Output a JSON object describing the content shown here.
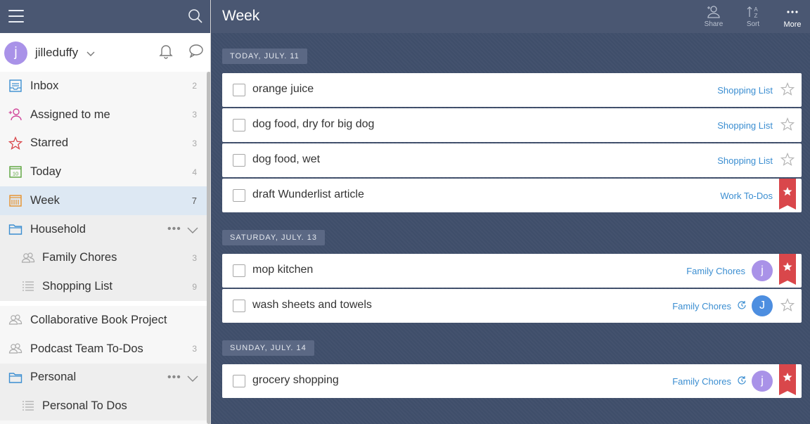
{
  "sidebar": {
    "user": {
      "initial": "j",
      "name": "jilleduffy"
    },
    "items": [
      {
        "label": "Inbox",
        "count": "2"
      },
      {
        "label": "Assigned to me",
        "count": "3"
      },
      {
        "label": "Starred",
        "count": "3"
      },
      {
        "label": "Today",
        "count": "4"
      },
      {
        "label": "Week",
        "count": "7"
      },
      {
        "label": "Household",
        "dots": "•••"
      },
      {
        "label": "Family Chores",
        "count": "3"
      },
      {
        "label": "Shopping List",
        "count": "9"
      },
      {
        "label": "Collaborative Book Project",
        "count": ""
      },
      {
        "label": "Podcast Team To-Dos",
        "count": "3"
      },
      {
        "label": "Personal",
        "dots": "•••"
      },
      {
        "label": "Personal To Dos",
        "count": ""
      }
    ],
    "today_icon_text": "10"
  },
  "header": {
    "title": "Week",
    "share_label": "Share",
    "sort_label": "Sort",
    "more_label": "More"
  },
  "groups": [
    {
      "date": "TODAY, JULY. 11",
      "tasks": [
        {
          "title": "orange juice",
          "list": "Shopping List",
          "starred": false
        },
        {
          "title": "dog food, dry for big dog",
          "list": "Shopping List",
          "starred": false
        },
        {
          "title": "dog food, wet",
          "list": "Shopping List",
          "starred": false
        },
        {
          "title": "draft Wunderlist article",
          "list": "Work To-Dos",
          "starred": true
        }
      ]
    },
    {
      "date": "SATURDAY, JULY. 13",
      "tasks": [
        {
          "title": "mop kitchen",
          "list": "Family Chores",
          "assignee": "j",
          "starred": true
        },
        {
          "title": "wash sheets and towels",
          "list": "Family Chores",
          "assignee": "J",
          "repeat": true,
          "starred": false
        }
      ]
    },
    {
      "date": "SUNDAY, JULY. 14",
      "tasks": [
        {
          "title": "grocery shopping",
          "list": "Family Chores",
          "assignee": "j",
          "repeat": true,
          "starred": true
        }
      ]
    }
  ],
  "colors": {
    "header_bg": "#4a5772",
    "main_bg": "#3f4e6a",
    "link": "#3b8ed1",
    "ribbon": "#d9474b",
    "avatar_purple": "#a992e8",
    "avatar_blue": "#4d8ee0"
  }
}
